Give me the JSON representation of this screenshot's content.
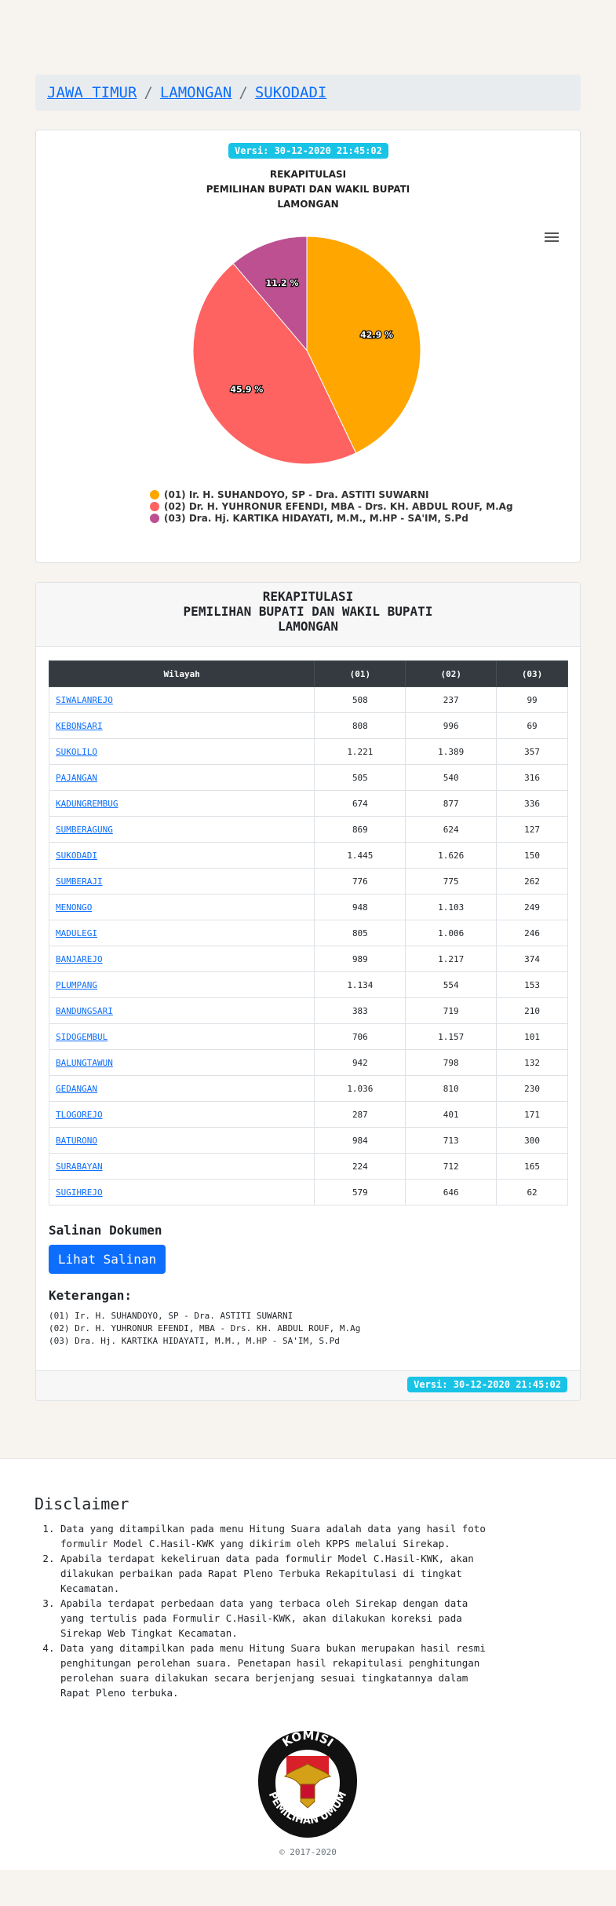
{
  "breadcrumb": {
    "items": [
      "JAWA TIMUR",
      "LAMONGAN",
      "SUKODADI"
    ],
    "separator": "/"
  },
  "version_label": "Versi: 30-12-2020 21:45:02",
  "chart_data": {
    "type": "pie",
    "title_lines": [
      "REKAPITULASI",
      "PEMILIHAN BUPATI DAN WAKIL BUPATI",
      "LAMONGAN"
    ],
    "series": [
      {
        "name": "(01) Ir. H. SUHANDOYO, SP - Dra. ASTITI SUWARNI",
        "value": 42.9,
        "label": "42.9 %",
        "color": "#ffa600"
      },
      {
        "name": "(02) Dr. H. YUHRONUR EFENDI, MBA - Drs. KH. ABDUL ROUF, M.Ag",
        "value": 45.9,
        "label": "45.9 %",
        "color": "#ff6361"
      },
      {
        "name": "(03) Dra. Hj. KARTIKA HIDAYATI, M.M., M.HP - SA'IM, S.Pd",
        "value": 11.2,
        "label": "11.2 %",
        "color": "#bc5090"
      }
    ],
    "legend_position": "bottom"
  },
  "table": {
    "title_lines": [
      "REKAPITULASI",
      "PEMILIHAN BUPATI DAN WAKIL BUPATI",
      "LAMONGAN"
    ],
    "headers": [
      "Wilayah",
      "(01)",
      "(02)",
      "(03)"
    ],
    "rows": [
      [
        "SIWALANREJO",
        "508",
        "237",
        "99"
      ],
      [
        "KEBONSARI",
        "808",
        "996",
        "69"
      ],
      [
        "SUKOLILO",
        "1.221",
        "1.389",
        "357"
      ],
      [
        "PAJANGAN",
        "505",
        "540",
        "316"
      ],
      [
        "KADUNGREMBUG",
        "674",
        "877",
        "336"
      ],
      [
        "SUMBERAGUNG",
        "869",
        "624",
        "127"
      ],
      [
        "SUKODADI",
        "1.445",
        "1.626",
        "150"
      ],
      [
        "SUMBERAJI",
        "776",
        "775",
        "262"
      ],
      [
        "MENONGO",
        "948",
        "1.103",
        "249"
      ],
      [
        "MADULEGI",
        "805",
        "1.006",
        "246"
      ],
      [
        "BANJAREJO",
        "989",
        "1.217",
        "374"
      ],
      [
        "PLUMPANG",
        "1.134",
        "554",
        "153"
      ],
      [
        "BANDUNGSARI",
        "383",
        "719",
        "210"
      ],
      [
        "SIDOGEMBUL",
        "706",
        "1.157",
        "101"
      ],
      [
        "BALUNGTAWUN",
        "942",
        "798",
        "132"
      ],
      [
        "GEDANGAN",
        "1.036",
        "810",
        "230"
      ],
      [
        "TLOGOREJO",
        "287",
        "401",
        "171"
      ],
      [
        "BATURONO",
        "984",
        "713",
        "300"
      ],
      [
        "SURABAYAN",
        "224",
        "712",
        "165"
      ],
      [
        "SUGIHREJO",
        "579",
        "646",
        "62"
      ]
    ]
  },
  "salinan": {
    "title": "Salinan Dokumen",
    "button_label": "Lihat Salinan"
  },
  "keterangan": {
    "title": "Keterangan:",
    "items": [
      "(01) Ir. H. SUHANDOYO, SP - Dra. ASTITI SUWARNI",
      "(02) Dr. H. YUHRONUR EFENDI, MBA - Drs. KH. ABDUL ROUF, M.Ag",
      "(03) Dra. Hj. KARTIKA HIDAYATI, M.M., M.HP - SA'IM, S.Pd"
    ]
  },
  "disclaimer": {
    "title": "Disclaimer",
    "items": [
      "Data yang ditampilkan pada menu Hitung Suara adalah data yang hasil foto formulir Model C.Hasil-KWK yang dikirim oleh KPPS melalui Sirekap.",
      "Apabila terdapat kekeliruan data pada formulir Model C.Hasil-KWK, akan dilakukan perbaikan pada Rapat Pleno Terbuka Rekapitulasi di tingkat Kecamatan.",
      "Apabila terdapat perbedaan data yang terbaca oleh Sirekap dengan data yang tertulis pada Formulir C.Hasil-KWK, akan dilakukan koreksi pada Sirekap Web Tingkat Kecamatan.",
      "Data yang ditampilkan pada menu Hitung Suara bukan merupakan hasil resmi penghitungan perolehan suara. Penetapan hasil rekapitulasi penghitungan perolehan suara dilakukan secara berjenjang sesuai tingkatannya dalam Rapat Pleno terbuka."
    ]
  },
  "logo": {
    "text_top": "KOMISI",
    "text_bottom": "PEMILIHAN UMUM"
  },
  "copyright": "© 2017-2020",
  "colors": {
    "accent": "#0d6efd",
    "badge": "#19c3e6"
  }
}
